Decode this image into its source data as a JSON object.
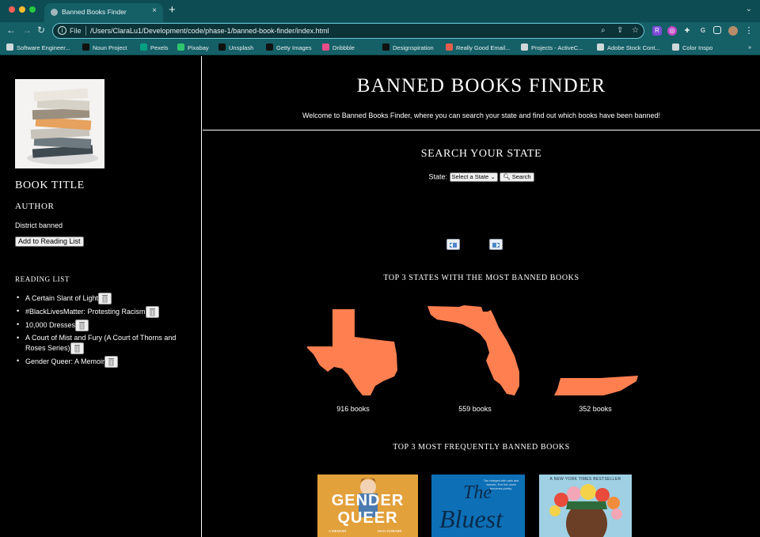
{
  "browser": {
    "tab_title": "Banned Books Finder",
    "new_tab": "+",
    "tab_close": "×",
    "scheme_label": "File",
    "url": "/Users/ClaraLu1/Development/code/phase-1/banned-book-finder/index.html",
    "bookmarks": [
      {
        "label": "Software Engineer...",
        "color": "#cfd8da"
      },
      {
        "label": "Noun Project",
        "color": "#111111"
      },
      {
        "label": "Pexels",
        "color": "#05a081"
      },
      {
        "label": "Pixabay",
        "color": "#2ec66d"
      },
      {
        "label": "Unsplash",
        "color": "#111111"
      },
      {
        "label": "Getty Images",
        "color": "#111111"
      },
      {
        "label": "Dribbble",
        "color": "#ea4c89"
      },
      {
        "label": "Designspiration",
        "color": "#111111"
      },
      {
        "label": "Really Good Email...",
        "color": "#e85d4a"
      },
      {
        "label": "Projects - ActiveC...",
        "color": "#cfd8da"
      },
      {
        "label": "Adobe Stock Cont...",
        "color": "#cfd8da"
      },
      {
        "label": "Color Inspo",
        "color": "#cfd8da"
      }
    ],
    "more_bookmarks": "»"
  },
  "sidebar": {
    "book_title": "BOOK TITLE",
    "author": "AUTHOR",
    "district": "District banned",
    "add_button": "Add to Reading List",
    "reading_list_heading": "READING LIST",
    "reading_list": [
      "A Certain Slant of Light",
      "#BlackLivesMatter: Protesting Racism",
      "10,000 Dresses",
      "A Court of Mist and Fury (A Court of Thorns and Roses Series)",
      "Gender Queer: A Memoir"
    ]
  },
  "header": {
    "title": "BANNED BOOKS FINDER",
    "subtitle": "Welcome to Banned Books Finder, where you can search your state and find out which books have been banned!"
  },
  "search": {
    "heading": "SEARCH YOUR STATE",
    "label": "State:",
    "select_value": "Select a State",
    "button": "Search"
  },
  "top_states": {
    "heading": "TOP 3 STATES WITH THE MOST BANNED BOOKS",
    "states": [
      {
        "count": "916 books",
        "color": "#ff7f50"
      },
      {
        "count": "559 books",
        "color": "#ff7f50"
      },
      {
        "count": "352 books",
        "color": "#ff7f50"
      }
    ]
  },
  "top_books": {
    "heading": "TOP 3 MOST FREQUENTLY BANNED BOOKS",
    "covers": [
      {
        "line1": "GENDER",
        "line2": "QUEER",
        "byline": "A MEMOIR",
        "author": "MAIA KOBABE"
      },
      {
        "title": "The",
        "title2": "Bluest",
        "blurb": "Too charged with pain and wonder, Eve the novel becomes poetry."
      },
      {
        "banner": "A NEW YORK TIMES BESTSELLER"
      }
    ]
  }
}
